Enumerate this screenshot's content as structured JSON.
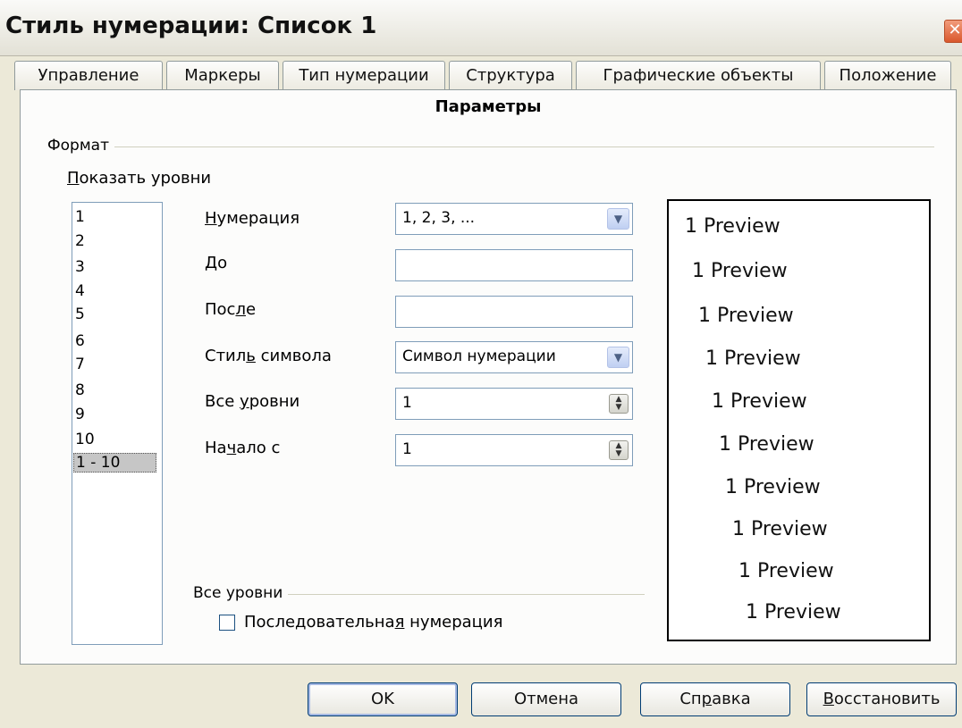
{
  "window": {
    "title": "Стиль нумерации: Список 1",
    "close_symbol": "✕"
  },
  "tabs": [
    {
      "label": "Управление"
    },
    {
      "label": "Маркеры"
    },
    {
      "label": "Тип нумерации"
    },
    {
      "label": "Структура"
    },
    {
      "label": "Графические объекты"
    },
    {
      "label": "Положение"
    },
    {
      "label": "Параметры"
    }
  ],
  "options": {
    "format_group": "Формат",
    "show_levels": {
      "accel": "П",
      "rest": "оказать уровни"
    },
    "levels": [
      "1",
      "2",
      "3",
      "4",
      "5",
      "6",
      "7",
      "8",
      "9",
      "10",
      "1 - 10"
    ],
    "selected_level": "1 - 10",
    "numbering": {
      "accel": "Н",
      "rest": "умерация",
      "value": "1, 2, 3, ..."
    },
    "before": {
      "accel": "Д",
      "rest": "о",
      "value": ""
    },
    "after": {
      "pre": "Пос",
      "accel": "л",
      "rest": "е",
      "value": ""
    },
    "char_style": {
      "pre": "Стил",
      "accel": "ь",
      "rest": " символа",
      "value": "Символ нумерации"
    },
    "all_levels": {
      "pre": "Все ",
      "accel": "у",
      "rest": "ровни",
      "value": "1"
    },
    "start_at": {
      "pre": "На",
      "accel": "ч",
      "rest": "ало с",
      "value": "1"
    },
    "all_levels_group": "Все уровни",
    "consecutive": {
      "pre": "Последовательна",
      "accel": "я",
      "rest": " нумерация",
      "checked": false
    },
    "preview_lines": [
      "1 Preview",
      "1 Preview",
      "1 Preview",
      "1 Preview",
      "1 Preview",
      "1 Preview",
      "1 Preview",
      "1 Preview",
      "1 Preview",
      "1 Preview"
    ]
  },
  "buttons": {
    "ok": "OK",
    "cancel": "Отмена",
    "help": {
      "pre": "Сп",
      "accel": "р",
      "rest": "авка"
    },
    "reset": {
      "accel": "В",
      "rest": "осстановить"
    }
  },
  "icons": {
    "dropdown": "chevron-down-icon",
    "spin": "spin-arrows-icon",
    "close": "close-icon"
  }
}
